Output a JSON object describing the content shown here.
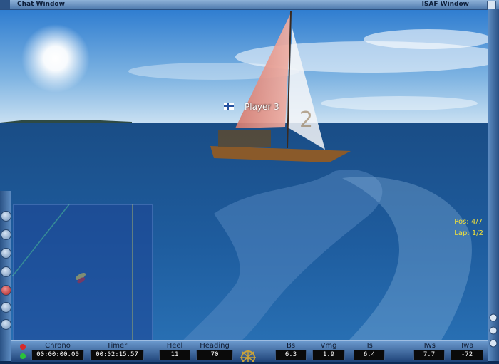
{
  "window": {
    "chat_label": "Chat Window",
    "isaf_label": "ISAF Window"
  },
  "scene": {
    "player_name": "Player 3",
    "sail_number": "2",
    "position": "Pos: 4/7",
    "lap": "Lap: 1/2"
  },
  "instruments": {
    "chrono": {
      "label": "Chrono",
      "value": "00:00:00.00"
    },
    "timer": {
      "label": "Timer",
      "value": "00:02:15.57"
    },
    "heel": {
      "label": "Heel",
      "value": "11"
    },
    "heading": {
      "label": "Heading",
      "value": "70"
    },
    "bs": {
      "label": "Bs",
      "value": "6.3"
    },
    "vmg": {
      "label": "Vmg",
      "value": "1.9"
    },
    "ts": {
      "label": "Ts",
      "value": "6.4"
    },
    "tws": {
      "label": "Tws",
      "value": "7.7"
    },
    "twa": {
      "label": "Twa",
      "value": "-72"
    }
  },
  "colors": {
    "sky": "#5a9ad8",
    "sea": "#1c5a9a",
    "hud_text": "#f2e13a",
    "frame": "#4d79ad"
  }
}
